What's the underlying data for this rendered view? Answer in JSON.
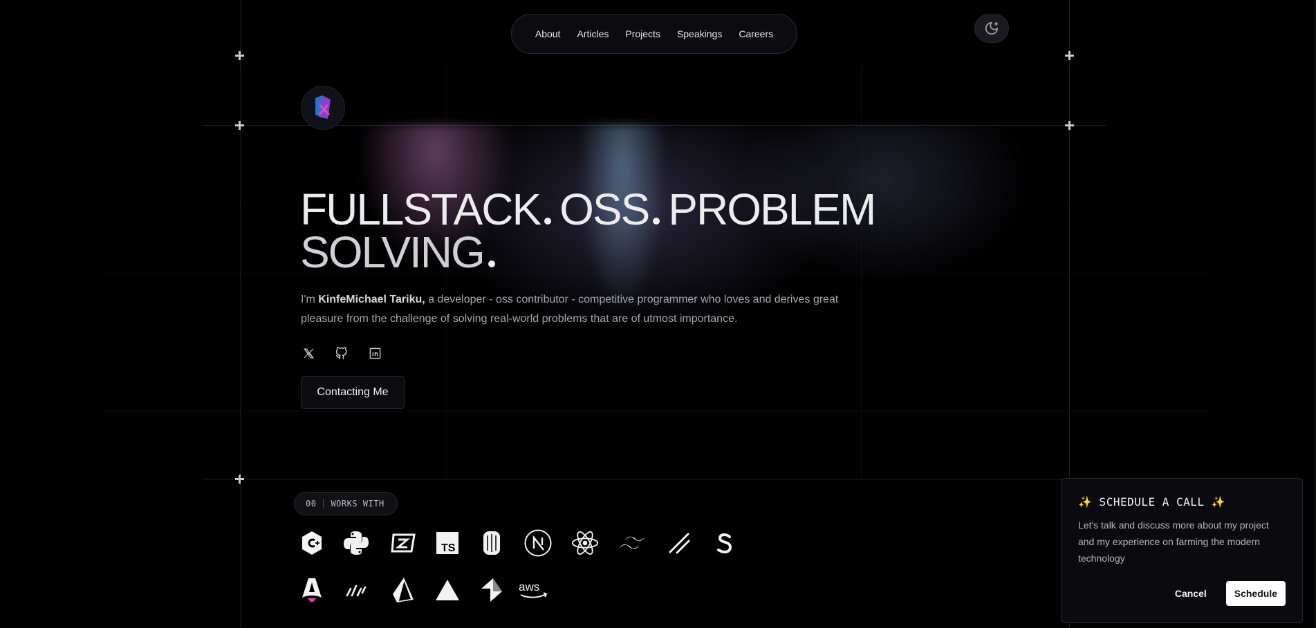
{
  "nav": {
    "items": [
      {
        "label": "About"
      },
      {
        "label": "Articles"
      },
      {
        "label": "Projects"
      },
      {
        "label": "Speakings"
      },
      {
        "label": "Careers"
      }
    ],
    "theme_icon": "moon-sparkle-icon"
  },
  "hero": {
    "headline_line1_a": "FULLSTACK",
    "headline_line1_b": "OSS",
    "headline_line1_c": "PROBLEM",
    "headline_line2": "SOLVING",
    "intro_prefix": "I'm ",
    "intro_name": "KinfeMichael Tariku,",
    "intro_rest": " a developer - oss contributor - competitive programmer who loves and derives great pleasure from the challenge of solving real-world problems that are of utmost importance.",
    "socials": [
      {
        "icon": "x-twitter-icon"
      },
      {
        "icon": "github-icon"
      },
      {
        "icon": "linkedin-icon"
      }
    ],
    "contact_label": "Contacting Me"
  },
  "works": {
    "badge_number": "00",
    "badge_label": "WORKS WITH",
    "tech_icons": [
      "cpp-icon",
      "python-icon",
      "zod-icon",
      "typescript-icon",
      "bun-icon",
      "nextjs-icon",
      "react-icon",
      "tailwind-icon",
      "shadcn-icon",
      "stripe-icon",
      "astro-icon",
      "hono-icon",
      "prisma-icon",
      "vercel-icon",
      "supabase-icon",
      "aws-icon"
    ],
    "aws_text": "aws"
  },
  "popup": {
    "title": "✨ SCHEDULE A CALL ✨",
    "text": "Let's talk and discuss more about my project and my experience on farming the modern technology",
    "cancel_label": "Cancel",
    "schedule_label": "Schedule"
  }
}
